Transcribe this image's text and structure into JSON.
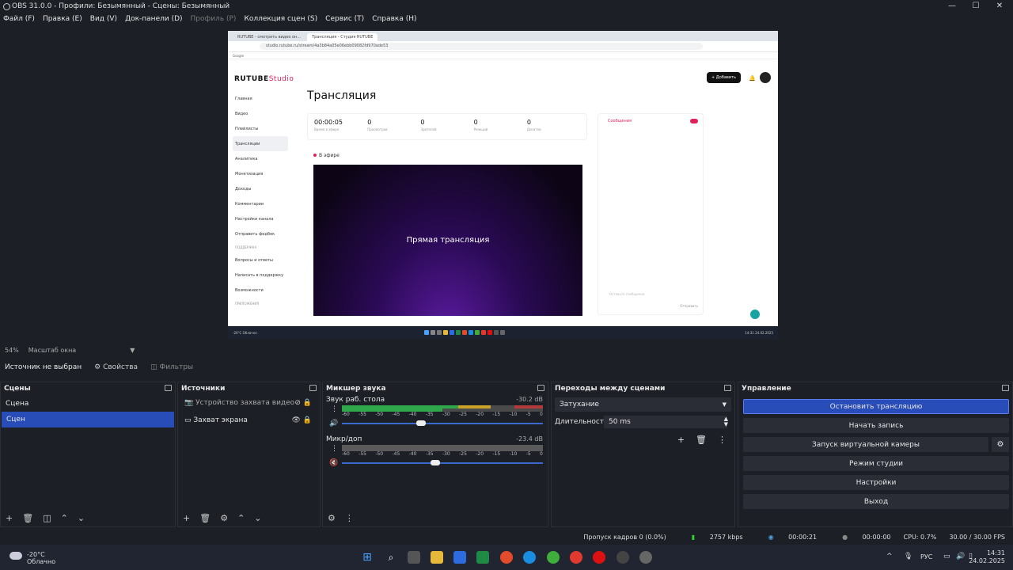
{
  "window": {
    "title": "OBS 31.0.0 - Профили: Безымянный - Сцены: Безымянный",
    "minimize": "—",
    "maximize": "☐",
    "close": "✕"
  },
  "menu": [
    "Файл (F)",
    "Правка (E)",
    "Вид (V)",
    "Док-панели (D)",
    "Профиль (P)",
    "Коллекция сцен (S)",
    "Сервис (T)",
    "Справка (H)"
  ],
  "preview": {
    "browser_tabs": [
      "RUTUBE - смотреть видео он...",
      "Трансляция - Студия RUTUBE"
    ],
    "url": "studio.rutube.ru/stream/4a3b84a05e06ebb09082fd970ade53",
    "bookmarks": "Google",
    "logo_main": "RUTUBE",
    "logo_sub": "Studio",
    "add_button": "+ Добавить",
    "page_title": "Трансляция",
    "sidebar": [
      "Главная",
      "Видео",
      "Плейлисты",
      "Трансляции",
      "Аналитика",
      "Монетизация",
      "Доходы",
      "Комментарии",
      "Настройки канала",
      "Отправить фидбек",
      "ПОДДЕРЖКА",
      "Вопросы и ответы",
      "Написать в поддержку",
      "Возможности",
      "ПРИЛОЖЕНИЯ"
    ],
    "stats": [
      {
        "value": "00:00:05",
        "label": "Время в эфире"
      },
      {
        "value": "0",
        "label": "Просмотров"
      },
      {
        "value": "0",
        "label": "Зрителей"
      },
      {
        "value": "0",
        "label": "Реакций"
      },
      {
        "value": "0",
        "label": "Донатов"
      }
    ],
    "chat_header": "Сообщения",
    "chat_input": "Оставьте сообщение",
    "chat_send": "Отправить",
    "live_heading": "В эфире",
    "live_text": "Прямая трансляция",
    "taskbar_weather": "-20°C Облачно",
    "taskbar_clock": "14:31 24.02.2025"
  },
  "zoom": {
    "value": "54%",
    "label": "Масштаб окна"
  },
  "source_bar": {
    "status": "Источник не выбран",
    "properties": "Свойства",
    "filters": "Фильтры"
  },
  "scenes": {
    "title": "Сцены",
    "items": [
      {
        "label": "Сцена"
      },
      {
        "label": "Сцен"
      }
    ],
    "selected": 1
  },
  "sources": {
    "title": "Источники",
    "items": [
      {
        "label": "Устройство захвата видео"
      },
      {
        "label": "Захват экрана"
      }
    ]
  },
  "mixer": {
    "title": "Микшер звука",
    "channels": [
      {
        "name": "Звук раб. стола",
        "db": "-30.2 dB",
        "level": 0.6,
        "volume": 0.38
      },
      {
        "name": "Микр/доп",
        "db": "-23.4 dB",
        "level": 0.0,
        "volume": 0.45
      }
    ],
    "scale": [
      "-60",
      "-55",
      "-50",
      "-45",
      "-40",
      "-35",
      "-30",
      "-25",
      "-20",
      "-15",
      "-10",
      "-5",
      "0"
    ]
  },
  "transitions": {
    "title": "Переходы между сценами",
    "selected": "Затухание",
    "duration_label": "Длительность",
    "duration_value": "50 ms"
  },
  "controls": {
    "title": "Управление",
    "stop_stream": "Остановить трансляцию",
    "start_record": "Начать запись",
    "virtual_camera": "Запуск виртуальной камеры",
    "studio_mode": "Режим студии",
    "settings": "Настройки",
    "exit": "Выход"
  },
  "status": {
    "dropped": "Пропуск кадров 0 (0.0%)",
    "bitrate": "2757 kbps",
    "stream_time": "00:00:21",
    "record_time": "00:00:00",
    "cpu": "CPU: 0.7%",
    "fps": "30.00 / 30.00 FPS"
  },
  "taskbar": {
    "temp": "-20°C",
    "weather": "Облачно",
    "lang": "РУС",
    "time": "14:31",
    "date": "24.02.2025"
  },
  "colors": {
    "accent": "#284cb8",
    "rutube": "#e0205b"
  }
}
